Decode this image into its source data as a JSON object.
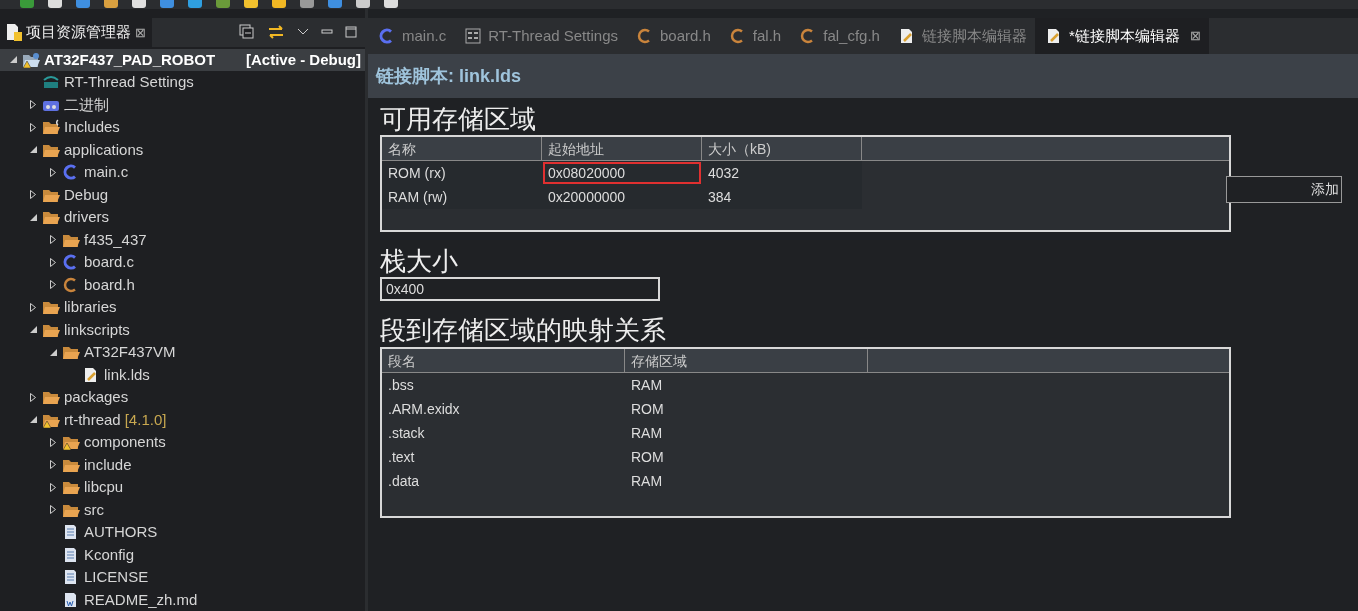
{
  "explorer": {
    "title": "项目资源管理器",
    "close": "⊠",
    "tree": [
      {
        "label": "AT32F437_PAD_ROBOT",
        "suffix": "[Active - Debug]",
        "kind": "project",
        "warning": true,
        "expanded": true,
        "selected": true,
        "children": [
          {
            "label": "RT-Thread Settings",
            "kind": "rt",
            "selected": false
          },
          {
            "label": "二进制",
            "kind": "binary",
            "expanded": false,
            "selected": false
          },
          {
            "label": "Includes",
            "kind": "includes",
            "expanded": false,
            "selected": false
          },
          {
            "label": "applications",
            "kind": "folder",
            "expanded": true,
            "selected": false,
            "children": [
              {
                "label": "main.c",
                "kind": "c-source",
                "expanded": false,
                "selected": false
              }
            ]
          },
          {
            "label": "Debug",
            "kind": "folder",
            "expanded": false,
            "selected": false
          },
          {
            "label": "drivers",
            "kind": "folder",
            "expanded": true,
            "selected": false,
            "children": [
              {
                "label": "f435_437",
                "kind": "folder",
                "expanded": false,
                "selected": false
              },
              {
                "label": "board.c",
                "kind": "c-source",
                "expanded": false,
                "selected": false
              },
              {
                "label": "board.h",
                "kind": "c-header",
                "expanded": false,
                "selected": false
              }
            ]
          },
          {
            "label": "libraries",
            "kind": "folder",
            "expanded": false,
            "selected": false
          },
          {
            "label": "linkscripts",
            "kind": "folder",
            "expanded": true,
            "selected": false,
            "children": [
              {
                "label": "AT32F437VM",
                "kind": "folder",
                "expanded": true,
                "selected": false,
                "children": [
                  {
                    "label": "link.lds",
                    "kind": "lds",
                    "selected": false
                  }
                ]
              }
            ]
          },
          {
            "label": "packages",
            "kind": "folder",
            "expanded": false,
            "selected": false
          },
          {
            "label": "rt-thread",
            "suffix": "[4.1.0]",
            "kind": "folder",
            "warning": true,
            "expanded": true,
            "selected": false,
            "children": [
              {
                "label": "components",
                "kind": "folder",
                "warning": true,
                "expanded": false,
                "selected": false
              },
              {
                "label": "include",
                "kind": "folder",
                "expanded": false,
                "selected": false
              },
              {
                "label": "libcpu",
                "kind": "folder",
                "expanded": false,
                "selected": false
              },
              {
                "label": "src",
                "kind": "folder",
                "expanded": false,
                "selected": false
              },
              {
                "label": "AUTHORS",
                "kind": "text",
                "selected": false
              },
              {
                "label": "Kconfig",
                "kind": "text",
                "selected": false
              },
              {
                "label": "LICENSE",
                "kind": "text",
                "selected": false
              },
              {
                "label": "README_zh.md",
                "kind": "word",
                "selected": false
              }
            ]
          }
        ]
      }
    ]
  },
  "editor_tabs": [
    {
      "label": "main.c",
      "kind": "c-source",
      "selected": false
    },
    {
      "label": "RT-Thread Settings",
      "kind": "settings",
      "selected": false
    },
    {
      "label": "board.h",
      "kind": "c-header",
      "selected": false
    },
    {
      "label": "fal.h",
      "kind": "c-header",
      "selected": false
    },
    {
      "label": "fal_cfg.h",
      "kind": "c-header",
      "selected": false
    },
    {
      "label": "链接脚本编辑器",
      "kind": "lds",
      "selected": false
    },
    {
      "label": "*链接脚本编辑器",
      "kind": "lds",
      "selected": true,
      "close": "⊠"
    }
  ],
  "editor": {
    "title": "链接脚本: link.lds",
    "memory": {
      "heading": "可用存储区域",
      "columns": [
        "名称",
        "起始地址",
        "大小（kB)"
      ],
      "rows": [
        {
          "cells": [
            "ROM (rx)",
            "0x08020000",
            "4032"
          ],
          "address_highlighted": true
        },
        {
          "cells": [
            "RAM (rw)",
            "0x20000000",
            "384"
          ],
          "address_highlighted": false
        }
      ],
      "add_button": "添加"
    },
    "stack": {
      "heading": "栈大小",
      "value": "0x400"
    },
    "mapping": {
      "heading": "段到存储区域的映射关系",
      "columns": [
        "段名",
        "存储区域"
      ],
      "rows": [
        [
          ".bss",
          "RAM"
        ],
        [
          ".ARM.exidx",
          "ROM"
        ],
        [
          ".stack",
          "RAM"
        ],
        [
          ".text",
          "ROM"
        ],
        [
          ".data",
          "RAM"
        ]
      ]
    }
  }
}
